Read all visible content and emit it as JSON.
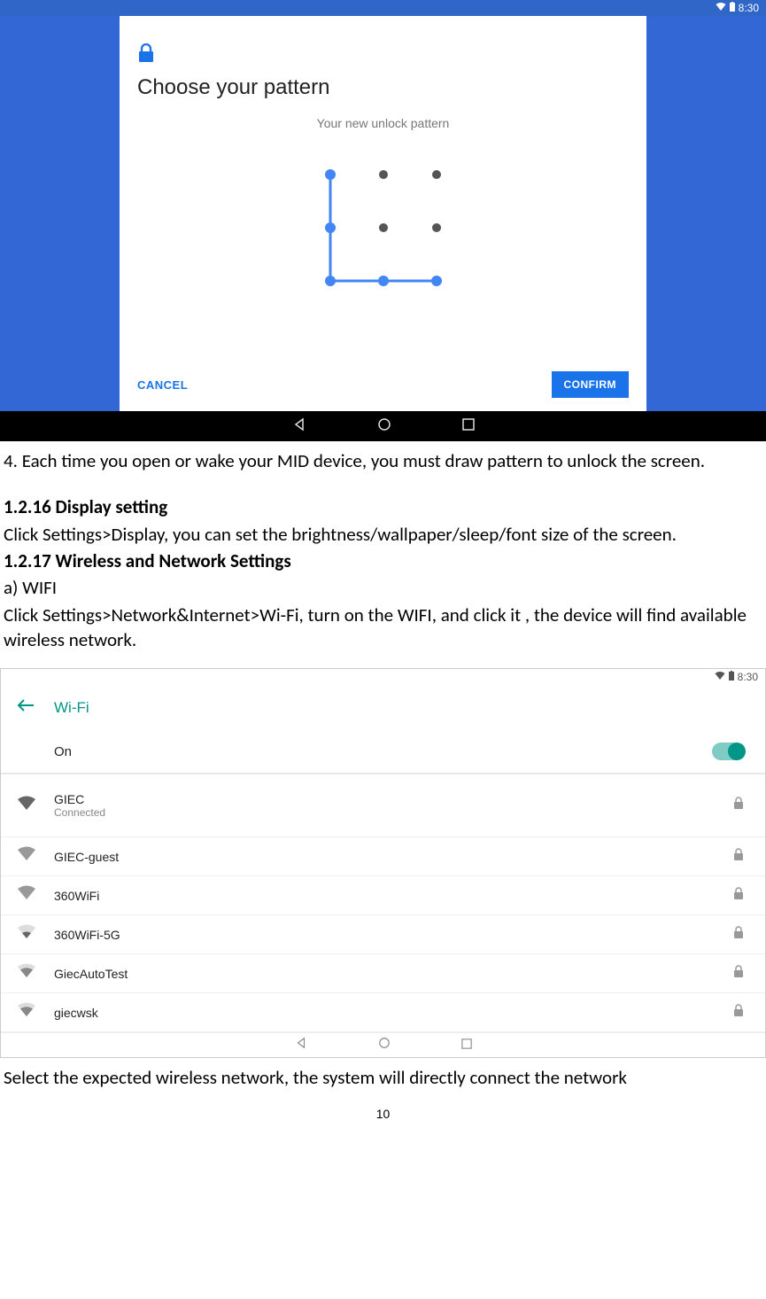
{
  "screenshot1": {
    "statusbar_time": "8:30",
    "title": "Choose your pattern",
    "subtitle": "Your new unlock pattern",
    "cancel": "CANCEL",
    "confirm": "CONFIRM"
  },
  "doc": {
    "p1": "4. Each time you open or wake your MID device, you must draw pattern to unlock the screen.",
    "h1": "1.2.16 Display setting",
    "p2": "Click Settings>Display, you can set the brightness/wallpaper/sleep/font size of the screen.",
    "h2": "1.2.17 Wireless and Network Settings",
    "p3": "a) WIFI",
    "p4": "Click Settings>Network&Internet>Wi-Fi, turn on the WIFI, and click it , the device will find available wireless network.",
    "p5": "Select the expected wireless network, the system will directly connect the network"
  },
  "screenshot2": {
    "statusbar_time": "8:30",
    "title": "Wi-Fi",
    "toggle_label": "On",
    "networks": [
      {
        "name": "GIEC",
        "status": "Connected",
        "locked": "true",
        "strength": "full"
      },
      {
        "name": "GIEC-guest",
        "status": "",
        "locked": "true",
        "strength": "full-gray"
      },
      {
        "name": "360WiFi",
        "status": "",
        "locked": "true",
        "strength": "full-gray"
      },
      {
        "name": "360WiFi-5G",
        "status": "",
        "locked": "true",
        "strength": "low"
      },
      {
        "name": "GiecAutoTest",
        "status": "",
        "locked": "true",
        "strength": "mid"
      },
      {
        "name": "giecwsk",
        "status": "",
        "locked": "true",
        "strength": "mid"
      }
    ]
  },
  "page_number": "10"
}
